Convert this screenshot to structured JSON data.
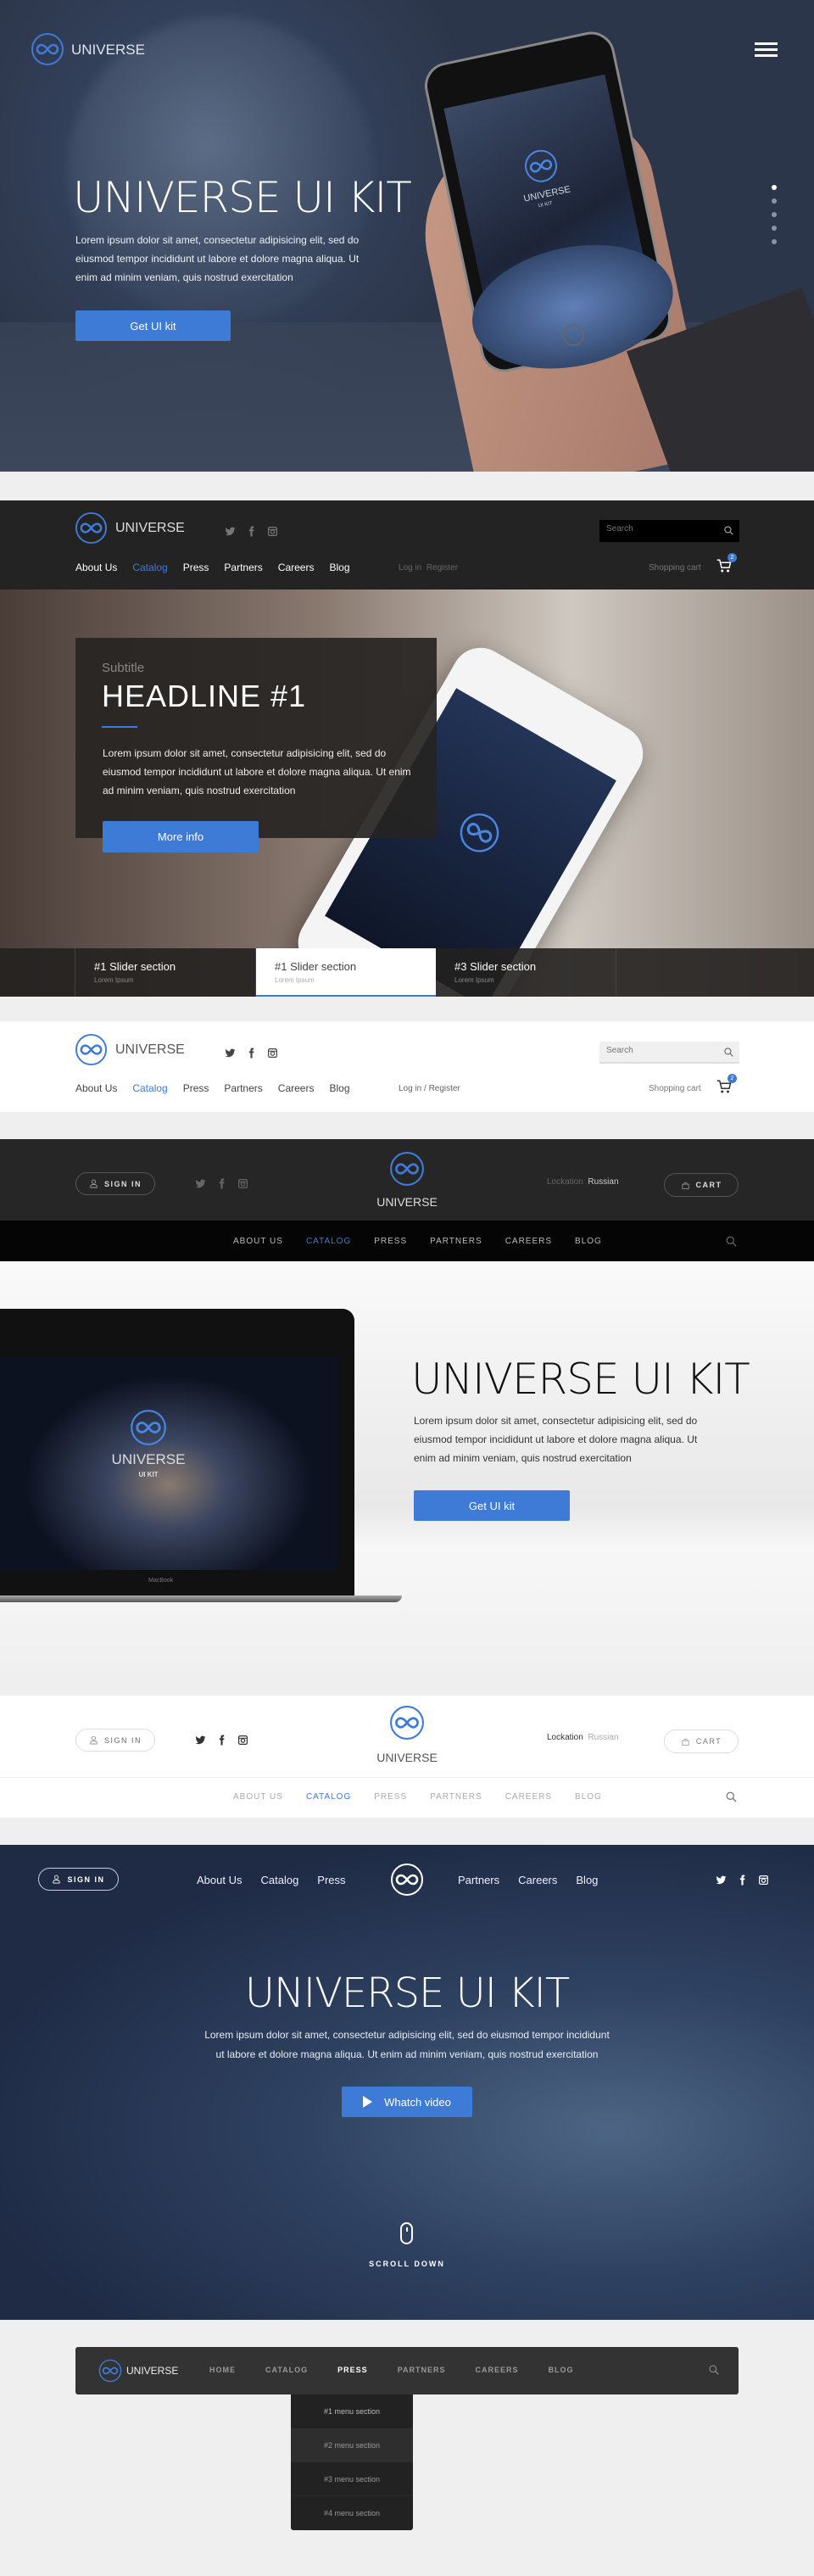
{
  "brand": "UNIVERSE",
  "colors": {
    "accent": "#3e7bd6",
    "dark": "#232323",
    "page_bg": "#efefef"
  },
  "hero1": {
    "title": "UNIVERSE UI KIT",
    "body": "Lorem ipsum dolor sit amet, consectetur adipisicing elit, sed do eiusmod tempor incididunt ut labore et dolore magna aliqua. Ut enim ad minim veniam, quis nostrud exercitation",
    "button": "Get UI kit",
    "phone_brand": "UNIVERSE",
    "phone_sub": "UI KIT",
    "slide_dots": 5,
    "active_dot": 1
  },
  "header_dark": {
    "nav": [
      "About Us",
      "Catalog",
      "Press",
      "Partners",
      "Careers",
      "Blog"
    ],
    "active": "Catalog",
    "login": "Log in",
    "register": "Register",
    "search_placeholder": "Search",
    "cart_label": "Shopping cart",
    "cart_count": "2"
  },
  "slider": {
    "subtitle": "Subtitle",
    "headline": "HEADLINE #1",
    "body": "Lorem ipsum dolor sit amet, consectetur adipisicing elit, sed do eiusmod tempor incididunt ut labore et dolore magna aliqua. Ut enim ad minim veniam, quis nostrud exercitation",
    "button": "More info",
    "tabs": [
      {
        "title": "#1 Slider section",
        "sub": "Lorem Ipsum"
      },
      {
        "title": "#1 Slider section",
        "sub": "Lorem Ipsum"
      },
      {
        "title": "#3 Slider section",
        "sub": "Lorem Ipsum"
      }
    ],
    "active_tab": 1
  },
  "header_light": {
    "nav": [
      "About Us",
      "Catalog",
      "Press",
      "Partners",
      "Careers",
      "Blog"
    ],
    "login_register": "Log in / Register",
    "search_placeholder": "Search",
    "cart_label": "Shopping cart",
    "cart_count": "2"
  },
  "header_center_dark": {
    "sign_in": "SIGN IN",
    "location_label": "Lockation",
    "location_value": "Russian",
    "cart": "CART",
    "nav": [
      "ABOUT US",
      "CATALOG",
      "PRESS",
      "PARTNERS",
      "CAREERS",
      "BLOG"
    ]
  },
  "laptop_hero": {
    "title": "UNIVERSE UI KIT",
    "body": "Lorem ipsum dolor sit amet, consectetur adipisicing elit, sed do eiusmod tempor incididunt ut labore et dolore magna aliqua. Ut enim ad minim veniam, quis nostrud exercitation",
    "button": "Get UI kit",
    "screen_brand": "UNIVERSE",
    "screen_sub": "UI KIT",
    "laptop_label": "MacBook"
  },
  "header_center_light": {
    "sign_in": "SIGN IN",
    "location_label": "Lockation",
    "location_value": "Russian",
    "cart": "CART",
    "nav": [
      "ABOUT US",
      "CATALOG",
      "PRESS",
      "PARTNERS",
      "CAREERS",
      "BLOG"
    ]
  },
  "space_hero": {
    "sign_in": "SIGN IN",
    "nav_left": [
      "About Us",
      "Catalog",
      "Press"
    ],
    "nav_right": [
      "Partners",
      "Careers",
      "Blog"
    ],
    "title": "UNIVERSE UI KIT",
    "body_line1": "Lorem ipsum dolor sit amet, consectetur adipisicing elit, sed do eiusmod tempor incididunt",
    "body_line2": "ut labore et dolore magna aliqua. Ut enim ad minim veniam, quis nostrud exercitation",
    "button": "Whatch video",
    "scroll": "SCROLL DOWN"
  },
  "dropdown_bar": {
    "nav": [
      "HOME",
      "CATALOG",
      "PRESS",
      "PARTNERS",
      "CAREERS",
      "BLOG"
    ],
    "active": "PRESS",
    "menu": [
      "#1 menu section",
      "#2 menu section",
      "#3 menu section",
      "#4 menu section"
    ],
    "hovered_item": 2
  }
}
